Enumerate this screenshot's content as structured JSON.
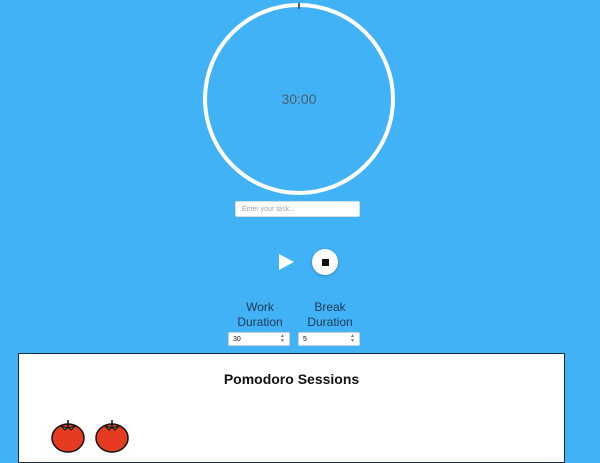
{
  "timer": {
    "time": "30:00",
    "progress_fraction": 0.0
  },
  "task": {
    "placeholder": "Enter your task..."
  },
  "controls": {
    "play_icon": "play-icon",
    "stop_icon": "stop-icon"
  },
  "durations": {
    "work": {
      "label": "Work Duration",
      "value": "30"
    },
    "break": {
      "label": "Break Duration",
      "value": "5"
    }
  },
  "sessions": {
    "title": "Pomodoro Sessions",
    "count": 2,
    "icon": "tomato-icon"
  },
  "colors": {
    "background": "#42b2f7",
    "ring": "#ffffff",
    "tomato": "#e53b21"
  }
}
